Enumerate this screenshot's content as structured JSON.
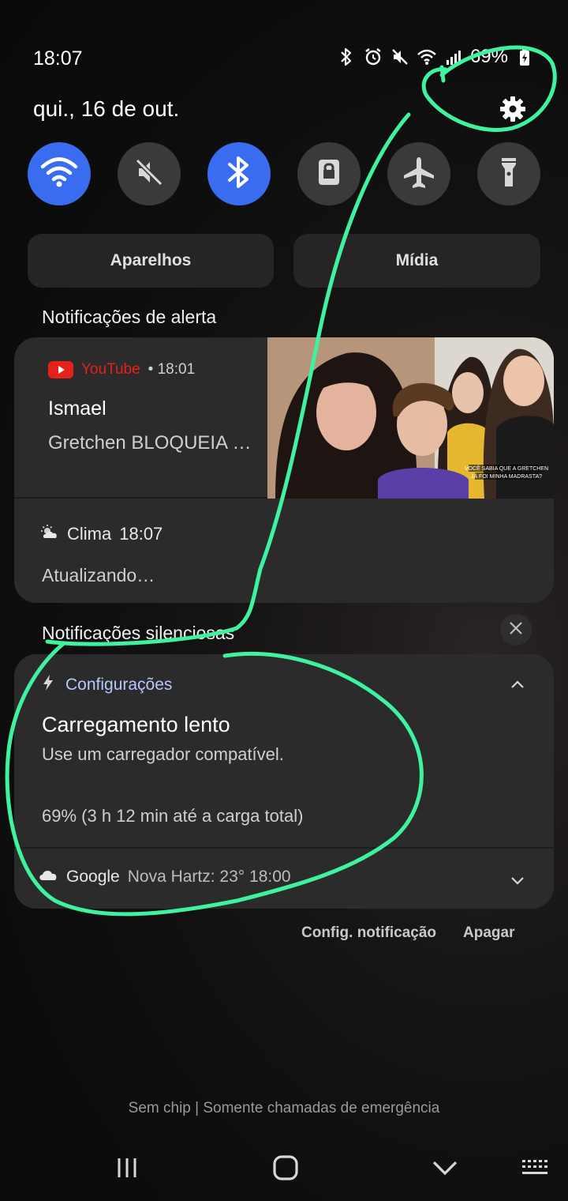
{
  "status_bar": {
    "time": "18:07",
    "battery_text": "69%",
    "icons": [
      "bluetooth-icon",
      "alarm-icon",
      "mute-icon",
      "wifi-icon",
      "signal-icon",
      "battery-charging-icon"
    ]
  },
  "header": {
    "date": "qui., 16 de out."
  },
  "quick_settings": [
    {
      "name": "wifi",
      "icon": "wifi-icon",
      "on": true
    },
    {
      "name": "sound",
      "icon": "mute-icon",
      "on": false
    },
    {
      "name": "bluetooth",
      "icon": "bluetooth-icon",
      "on": true
    },
    {
      "name": "lock",
      "icon": "lock-icon",
      "on": false
    },
    {
      "name": "airplane",
      "icon": "airplane-icon",
      "on": false
    },
    {
      "name": "flashlight",
      "icon": "flashlight-icon",
      "on": false
    }
  ],
  "buttons": {
    "devices": "Aparelhos",
    "media": "Mídia"
  },
  "alert_section": {
    "title": "Notificações de alerta",
    "youtube": {
      "app": "YouTube",
      "time": "• 18:01",
      "title": "Ismael",
      "body": "Gretchen BLOQUEIA …",
      "thumb_caption_1": "VOCÊ SABIA QUE A GRETCHEN",
      "thumb_caption_2": "JÁ FOI MINHA MADRASTA?"
    },
    "clima": {
      "app": "Clima",
      "time": "18:07",
      "body": "Atualizando…"
    }
  },
  "silent_section": {
    "title": "Notificações silenciosas",
    "config": {
      "app": "Configurações",
      "title": "Carregamento lento",
      "subtitle": "Use um carregador compatível.",
      "status": "69% (3 h 12 min até a carga total)"
    },
    "google": {
      "app": "Google",
      "text": "Nova Hartz: 23°  18:00"
    }
  },
  "actions": {
    "settings": "Config. notificação",
    "clear": "Apagar"
  },
  "network_text": "Sem chip | Somente chamadas de emergência",
  "colors": {
    "accent": "#3a6cf0",
    "annotation": "#3ef2a0",
    "youtube_red": "#e62117"
  }
}
